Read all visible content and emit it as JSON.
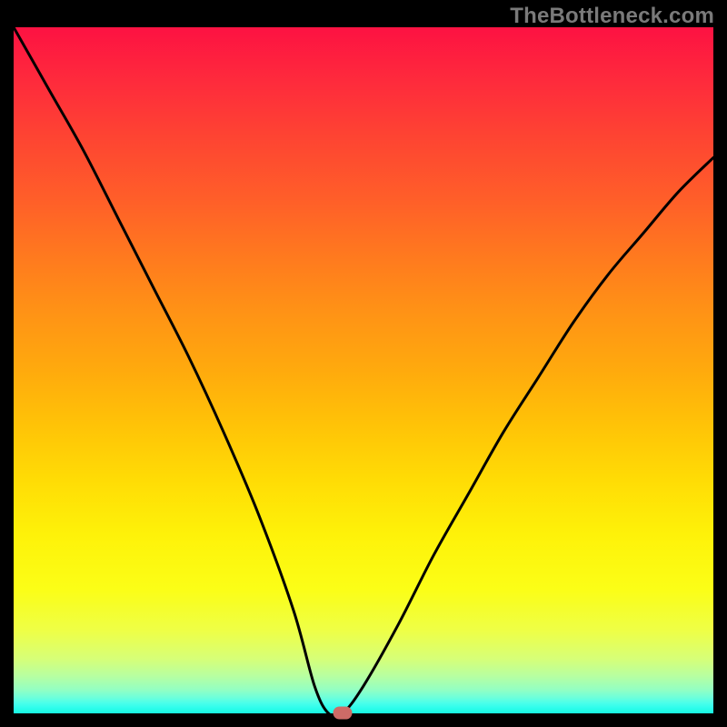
{
  "attribution": "TheBottleneck.com",
  "colors": {
    "curve_stroke": "#000000",
    "marker_fill": "#cd6b67"
  },
  "chart_data": {
    "type": "line",
    "title": "",
    "xlabel": "",
    "ylabel": "",
    "xlim": [
      0,
      100
    ],
    "ylim": [
      0,
      100
    ],
    "annotations": [
      {
        "name": "minimum-marker",
        "x": 47,
        "y": 0
      }
    ],
    "series": [
      {
        "name": "bottleneck-curve",
        "x": [
          0,
          5,
          10,
          15,
          20,
          25,
          30,
          35,
          40,
          43,
          45,
          47,
          50,
          55,
          60,
          65,
          70,
          75,
          80,
          85,
          90,
          95,
          100
        ],
        "values": [
          100,
          91,
          82,
          72,
          62,
          52,
          41,
          29,
          15,
          4,
          0,
          0,
          4,
          13,
          23,
          32,
          41,
          49,
          57,
          64,
          70,
          76,
          81
        ]
      }
    ]
  }
}
